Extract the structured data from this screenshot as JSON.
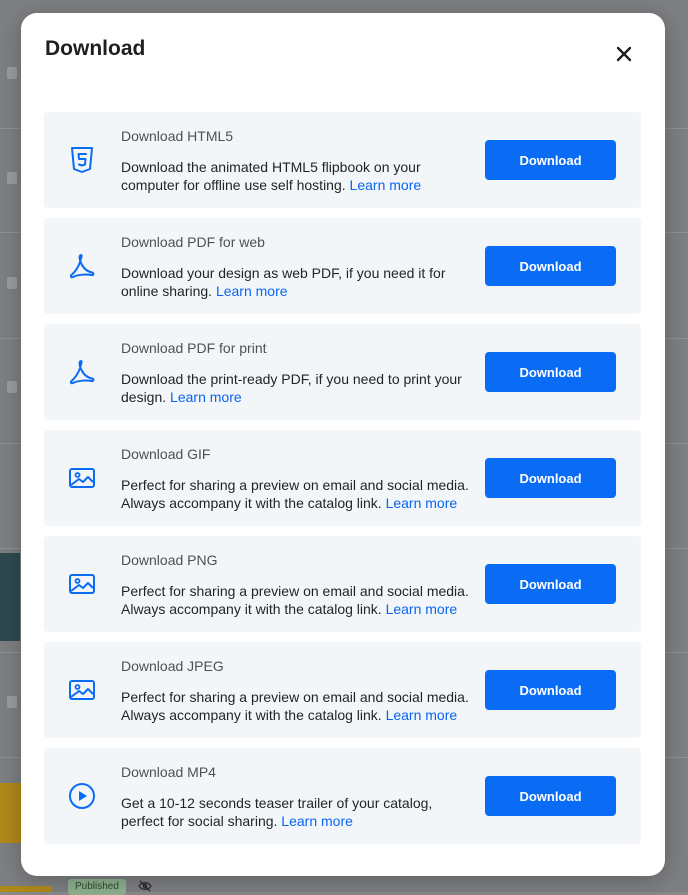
{
  "modal": {
    "title": "Download",
    "options": [
      {
        "icon": "html5-icon",
        "title": "Download HTML5",
        "description": "Download the animated HTML5 flipbook on your computer for offline use self hosting.",
        "link": "Learn more",
        "button": "Download"
      },
      {
        "icon": "pdf-icon",
        "title": "Download PDF for web",
        "description": "Download your design as web PDF, if you need it for online sharing.",
        "link": "Learn more",
        "button": "Download"
      },
      {
        "icon": "pdf-icon",
        "title": "Download PDF for print",
        "description": "Download the print-ready PDF, if you need to print your design.",
        "link": "Learn more",
        "button": "Download"
      },
      {
        "icon": "image-icon",
        "title": "Download GIF",
        "description": "Perfect for sharing a preview on email and social media. Always accompany it with the catalog link.",
        "link": "Learn more",
        "button": "Download"
      },
      {
        "icon": "image-icon",
        "title": "Download PNG",
        "description": "Perfect for sharing a preview on email and social media. Always accompany it with the catalog link.",
        "link": "Learn more",
        "button": "Download"
      },
      {
        "icon": "image-icon",
        "title": "Download JPEG",
        "description": "Perfect for sharing a preview on email and social media. Always accompany it with the catalog link.",
        "link": "Learn more",
        "button": "Download"
      },
      {
        "icon": "play-icon",
        "title": "Download MP4",
        "description": "Get a 10-12 seconds teaser trailer of your catalog, perfect for social sharing.",
        "link": "Learn more",
        "button": "Download"
      }
    ]
  },
  "background": {
    "status_badge": "Published"
  },
  "colors": {
    "accent": "#0a6cf5",
    "link": "#0a64f0",
    "option_bg": "#f3f6f9"
  }
}
